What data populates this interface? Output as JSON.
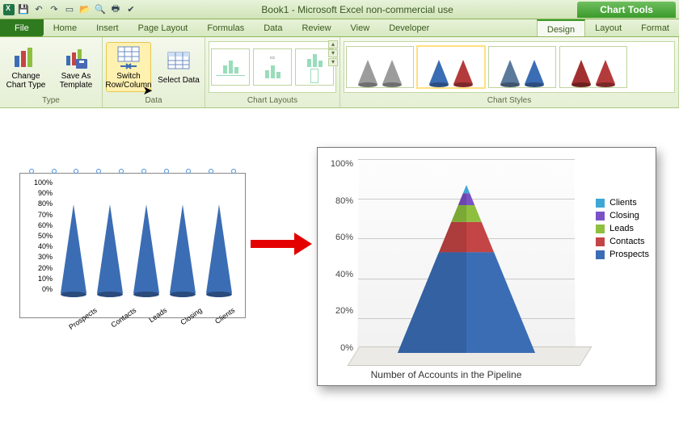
{
  "app": {
    "title": "Book1 - Microsoft Excel non-commercial use",
    "chart_tools_label": "Chart Tools"
  },
  "qat": {
    "icons": [
      "excel-icon",
      "save-icon",
      "undo-icon",
      "redo-icon",
      "new-icon",
      "open-icon",
      "print-preview-icon",
      "quick-print-icon",
      "spelling-icon"
    ]
  },
  "tabs": {
    "file": "File",
    "items": [
      "Home",
      "Insert",
      "Page Layout",
      "Formulas",
      "Data",
      "Review",
      "View",
      "Developer"
    ],
    "chart_tabs": [
      "Design",
      "Layout",
      "Format"
    ],
    "active": "Design"
  },
  "ribbon": {
    "type_group": {
      "label": "Type",
      "change_chart_type": "Change Chart Type",
      "save_as_template": "Save As Template"
    },
    "data_group": {
      "label": "Data",
      "switch_row_column": "Switch Row/Column",
      "select_data": "Select Data"
    },
    "layouts_group": {
      "label": "Chart Layouts"
    },
    "styles_group": {
      "label": "Chart Styles"
    }
  },
  "small_chart": {
    "y_ticks": [
      "100%",
      "90%",
      "80%",
      "70%",
      "60%",
      "50%",
      "40%",
      "30%",
      "20%",
      "10%",
      "0%"
    ],
    "x_labels": [
      "Prospects",
      "Contacts",
      "Leads",
      "Closing",
      "Clients"
    ]
  },
  "big_chart": {
    "y_ticks": [
      "100%",
      "80%",
      "60%",
      "40%",
      "20%",
      "0%"
    ],
    "title": "Number of Accounts in the Pipeline",
    "legend": [
      {
        "label": "Clients",
        "color": "#3fa7d6"
      },
      {
        "label": "Closing",
        "color": "#7a52c6"
      },
      {
        "label": "Leads",
        "color": "#8fbf3f"
      },
      {
        "label": "Contacts",
        "color": "#c44545"
      },
      {
        "label": "Prospects",
        "color": "#3b6db4"
      }
    ]
  },
  "chart_data": [
    {
      "type": "bar",
      "note": "small chart: 100% stacked 3D cone, single series shown at 100% per category before switch",
      "categories": [
        "Prospects",
        "Contacts",
        "Leads",
        "Closing",
        "Clients"
      ],
      "values": [
        100,
        100,
        100,
        100,
        100
      ],
      "ylabel": "",
      "xlabel": "",
      "ylim": [
        0,
        100
      ],
      "y_format": "percent"
    },
    {
      "type": "bar",
      "note": "big chart: 100% stacked pyramid after Switch Row/Column; single column with 5 stacked series (approx shares)",
      "categories": [
        "Accounts"
      ],
      "series": [
        {
          "name": "Prospects",
          "values": [
            60
          ],
          "color": "#3b6db4"
        },
        {
          "name": "Contacts",
          "values": [
            18
          ],
          "color": "#c44545"
        },
        {
          "name": "Leads",
          "values": [
            10
          ],
          "color": "#8fbf3f"
        },
        {
          "name": "Closing",
          "values": [
            7
          ],
          "color": "#7a52c6"
        },
        {
          "name": "Clients",
          "values": [
            5
          ],
          "color": "#3fa7d6"
        }
      ],
      "title": "Number of Accounts in the Pipeline",
      "ylim": [
        0,
        100
      ],
      "y_format": "percent"
    }
  ]
}
